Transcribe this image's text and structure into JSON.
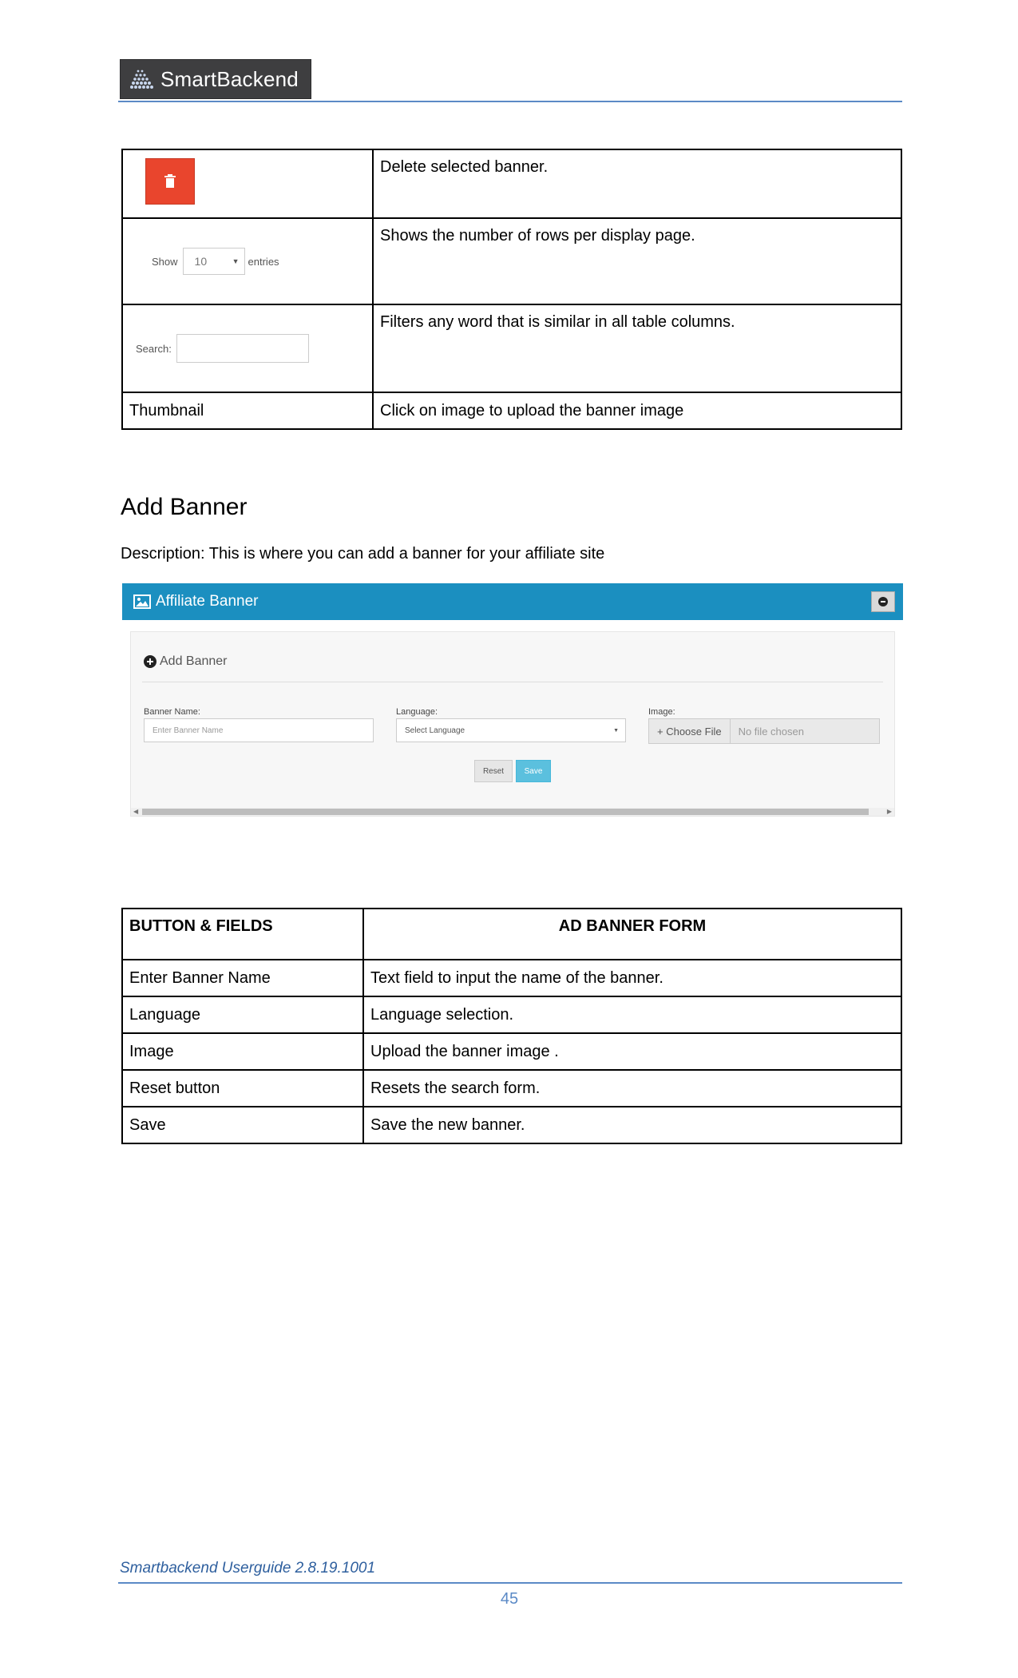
{
  "header": {
    "logo_text": "SmartBackend"
  },
  "table1": {
    "rows": [
      {
        "desc": "Delete selected banner."
      },
      {
        "show_label": "Show",
        "show_value": "10",
        "entries_label": "entries",
        "desc": "Shows the number of rows per display page."
      },
      {
        "search_label": "Search:",
        "desc": "Filters any word that is similar in all table columns."
      },
      {
        "label": "Thumbnail",
        "desc": "Click on image to upload the banner image"
      }
    ]
  },
  "section": {
    "title": "Add Banner",
    "description": "Description: This is where you can add a banner for your affiliate site"
  },
  "screenshot": {
    "panel_title": "Affiliate Banner",
    "add_banner_label": "Add Banner",
    "banner_name_label": "Banner Name:",
    "banner_name_placeholder": "Enter Banner Name",
    "language_label": "Language:",
    "language_value": "Select Language",
    "image_label": "Image:",
    "choose_file": "+ Choose File",
    "no_file": "No file chosen",
    "reset": "Reset",
    "save": "Save"
  },
  "table2": {
    "header": {
      "col1": "BUTTON & FIELDS",
      "col2": "AD BANNER FORM"
    },
    "rows": [
      {
        "field": "Enter Banner Name",
        "desc": "Text field to input the name of the banner."
      },
      {
        "field": "Language",
        "desc": "Language selection."
      },
      {
        "field": "Image",
        "desc": "Upload the banner image ."
      },
      {
        "field": "Reset button",
        "desc": "Resets the search form."
      },
      {
        "field": "Save",
        "desc": "Save the new banner."
      }
    ]
  },
  "footer": {
    "guide": "Smartbackend Userguide 2.8.19.1001",
    "page": "45"
  },
  "colors": {
    "accent": "#1b8fc0",
    "delete_red": "#e9452d",
    "save_blue": "#5bc0de",
    "rule_blue": "#5b8ac6"
  }
}
